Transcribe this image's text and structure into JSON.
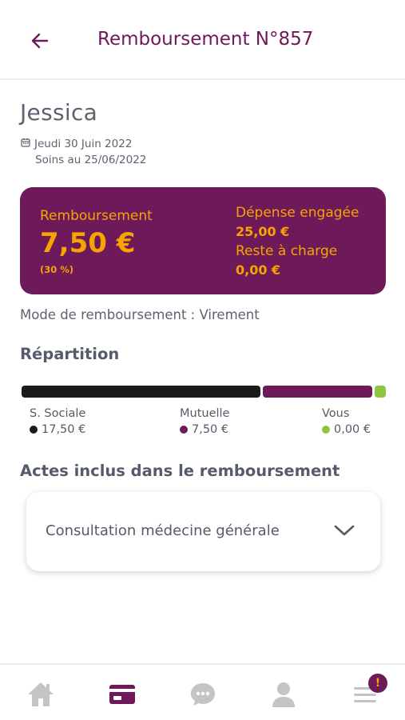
{
  "header": {
    "title": "Remboursement N°857"
  },
  "patient": {
    "name": "Jessica",
    "date": "Jeudi 30 Juin 2022",
    "soins": "Soins au 25/06/2022"
  },
  "summary": {
    "rb_label": "Remboursement",
    "rb_amount": "7,50 €",
    "rb_percent": "(30 %)",
    "depense_label": "Dépense engagée",
    "depense_amount": "25,00 €",
    "reste_label": "Reste à charge",
    "reste_amount": "0,00 €"
  },
  "mode": {
    "label": "Mode de remboursement :",
    "value": "Virement"
  },
  "repartition": {
    "title": "Répartition",
    "items": [
      {
        "label": "S. Sociale",
        "value": "17,50 €",
        "color": "#1b1b1b"
      },
      {
        "label": "Mutuelle",
        "value": "7,50 €",
        "color": "#6e1a5a"
      },
      {
        "label": "Vous",
        "value": "0,00 €",
        "color": "#8dc63f"
      }
    ]
  },
  "actes": {
    "title": "Actes inclus dans le remboursement",
    "items": [
      {
        "label": "Consultation médecine générale"
      }
    ]
  },
  "nav": {
    "items": [
      "home-icon",
      "card-icon",
      "chat-icon",
      "user-icon",
      "menu-icon"
    ],
    "active": "card-icon",
    "badge": "!"
  },
  "colors": {
    "brand": "#6e1a5a",
    "accent": "#f6a400",
    "muted": "#c4c4c4"
  }
}
